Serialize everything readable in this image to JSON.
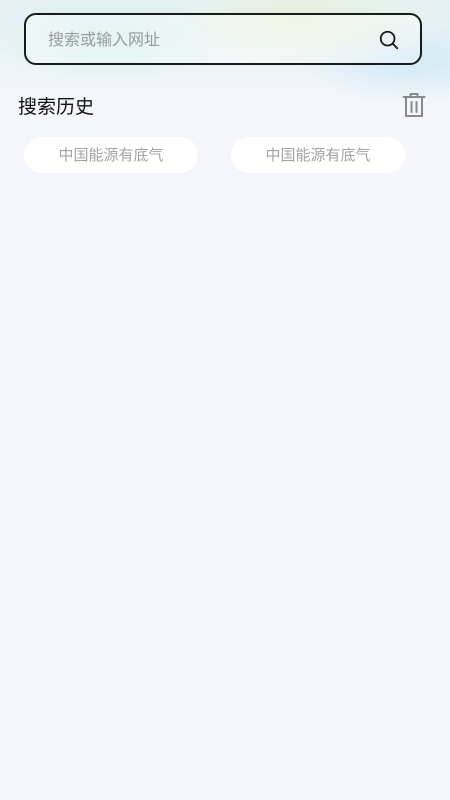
{
  "search": {
    "placeholder": "搜索或输入网址",
    "value": ""
  },
  "history": {
    "title": "搜索历史",
    "items": [
      {
        "label": "中国能源有底气"
      },
      {
        "label": "中国能源有底气"
      }
    ]
  },
  "icons": {
    "search": "search-icon",
    "clear_history": "trash-icon"
  },
  "colors": {
    "background": "#f4f6fb",
    "search_border": "#1a1a1a",
    "chip_background": "#ffffff",
    "chip_text": "#a3a3a3",
    "icon_gray": "#8a8a8a"
  }
}
